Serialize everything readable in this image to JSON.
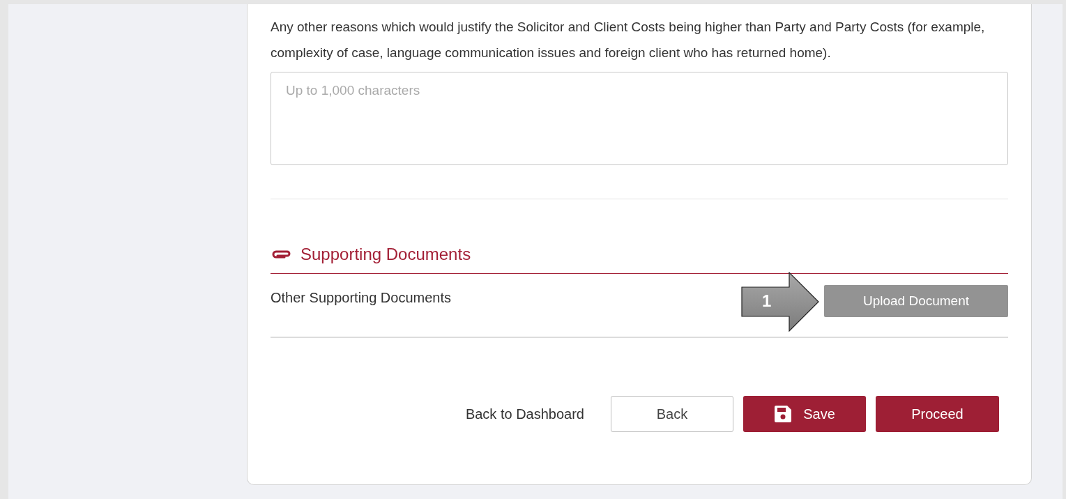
{
  "question": {
    "text": "Any other reasons which would justify the Solicitor and Client Costs being higher than Party and Party Costs (for example, complexity of case, language communication issues and foreign client who has returned home).",
    "placeholder": "Up to 1,000 characters"
  },
  "supporting_documents": {
    "title": "Supporting Documents",
    "rows": [
      {
        "label": "Other Supporting Documents",
        "button": "Upload Document",
        "disabled": true
      }
    ]
  },
  "callout": {
    "label": "1"
  },
  "footer": {
    "link": "Back to Dashboard",
    "buttons": [
      {
        "label": "Back",
        "kind": "outline"
      },
      {
        "label": "Save",
        "kind": "save"
      },
      {
        "label": "Proceed",
        "kind": "primary"
      }
    ]
  }
}
